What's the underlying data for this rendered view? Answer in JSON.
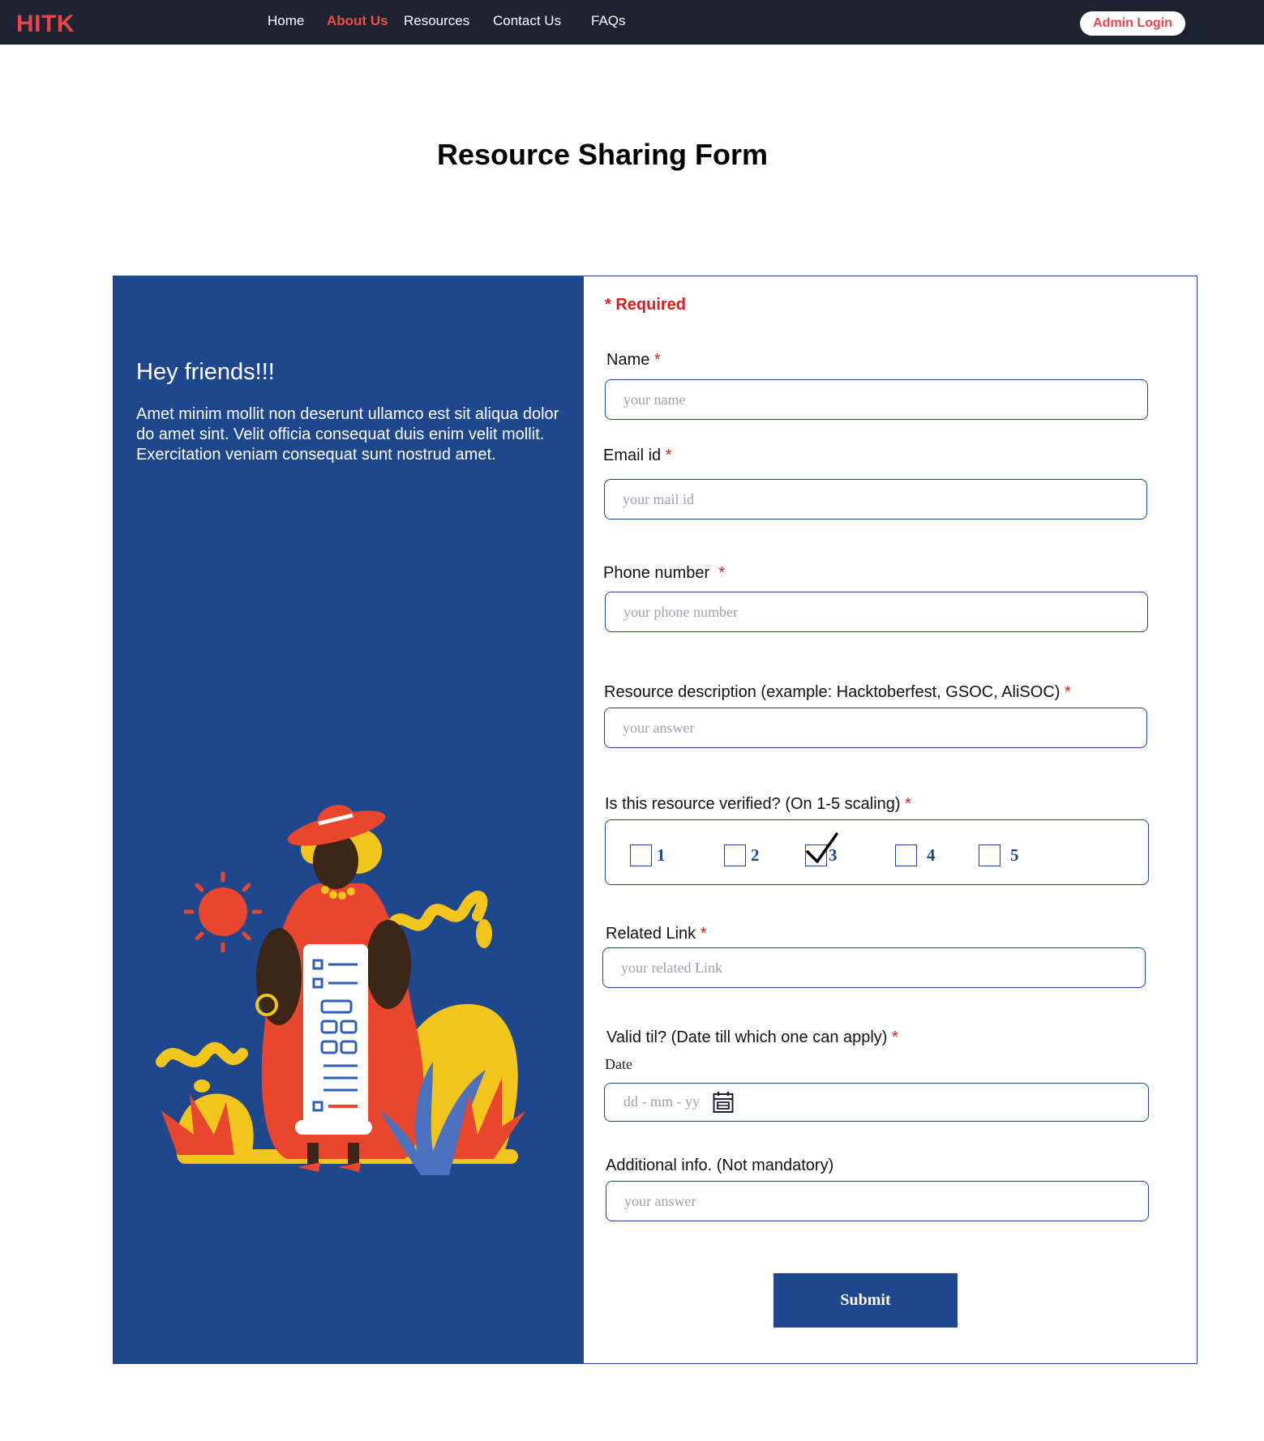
{
  "nav": {
    "brand": "HITK",
    "links": [
      "Home",
      "About Us",
      "Resources",
      "Contact Us",
      "FAQs"
    ],
    "admin_label": "Admin Login"
  },
  "page": {
    "title": "Resource Sharing Form"
  },
  "left": {
    "title": "Hey friends!!!",
    "text": "Amet minim mollit non deserunt ullamco est sit aliqua dolor do amet sint. Velit officia consequat duis enim velit mollit. Exercitation veniam consequat sunt nostrud amet."
  },
  "form": {
    "required_note": "* Required",
    "name": {
      "label": "Name",
      "placeholder": "your name"
    },
    "email": {
      "label": "Email id",
      "placeholder": "your mail id"
    },
    "phone": {
      "label": "Phone number",
      "placeholder": "your phone number"
    },
    "description": {
      "label": "Resource description (example: Hacktoberfest, GSOC, AliSOC)",
      "placeholder": "your answer"
    },
    "verified": {
      "label": "Is this resource verified? (On 1-5 scaling)",
      "options": [
        "1",
        "2",
        "3",
        "4",
        "5"
      ],
      "selected": "3"
    },
    "link": {
      "label": "Related Link",
      "placeholder": "your related Link"
    },
    "valid": {
      "label": "Valid til? (Date till which one can apply)",
      "sub": "Date",
      "placeholder": "dd - mm - yy"
    },
    "additional": {
      "label": "Additional info. (Not mandatory)",
      "placeholder": "your answer"
    },
    "submit_label": "Submit"
  },
  "colors": {
    "brand": "#e8454a",
    "primary": "#1f478e",
    "nav_bg": "#1d2330",
    "required": "#e01b1b"
  }
}
